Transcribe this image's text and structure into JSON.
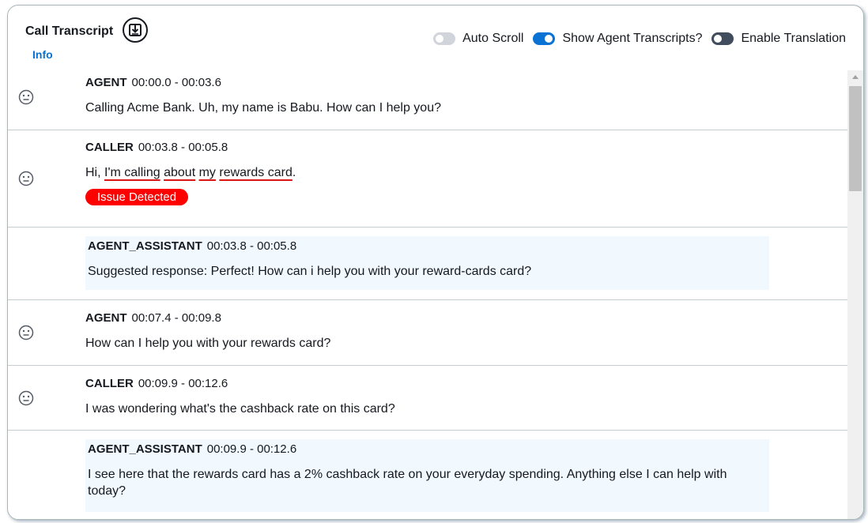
{
  "header": {
    "title": "Call Transcript",
    "info_label": "Info",
    "download_icon": "download-icon"
  },
  "toggles": [
    {
      "label": "Auto Scroll",
      "state": "off"
    },
    {
      "label": "Show Agent Transcripts?",
      "state": "on"
    },
    {
      "label": "Enable Translation",
      "state": "off"
    }
  ],
  "colors": {
    "accent": "#0972d3",
    "issue": "#ff0000",
    "assistant_bg": "#f1f8fe",
    "underline": "#d91515"
  },
  "transcript": {
    "row1": {
      "speaker": "AGENT",
      "time": "00:00.0 - 00:03.6",
      "text": "Calling Acme Bank. Uh, my name is Babu. How can I help you?",
      "sentiment_icon": "neutral-face-icon"
    },
    "row2": {
      "speaker": "CALLER",
      "time": "00:03.8 - 00:05.8",
      "text_prefix": "Hi, ",
      "t1": "I'm calling",
      "t2": "about",
      "t3": "my",
      "t4": "rewards card",
      "text_suffix": ".",
      "badge": "Issue Detected",
      "sentiment_icon": "neutral-face-icon"
    },
    "row3": {
      "speaker": "AGENT_ASSISTANT",
      "time": "00:03.8 - 00:05.8",
      "text": "Suggested response: Perfect! How can i help you with your reward-cards card?"
    },
    "row4": {
      "speaker": "AGENT",
      "time": "00:07.4 - 00:09.8",
      "text": "How can I help you with your rewards card?",
      "sentiment_icon": "neutral-face-icon"
    },
    "row5": {
      "speaker": "CALLER",
      "time": "00:09.9 - 00:12.6",
      "text": "I was wondering what's the cashback rate on this card?",
      "sentiment_icon": "neutral-face-icon"
    },
    "row6": {
      "speaker": "AGENT_ASSISTANT",
      "time": "00:09.9 - 00:12.6",
      "text_line1": "I see here that the rewards card has a 2% cashback rate on your everyday spending. Anything else I can help with",
      "text_line2": "today?"
    }
  }
}
